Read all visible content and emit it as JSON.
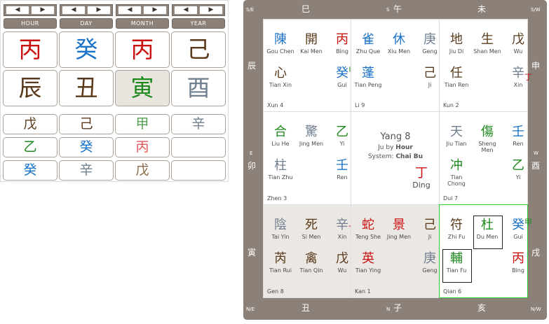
{
  "left_panel": {
    "nav_prev": "◀",
    "nav_next": "▶",
    "columns": [
      "HOUR",
      "DAY",
      "MONTH",
      "YEAR"
    ],
    "stems": [
      {
        "char": "丙",
        "color": "#cc1111"
      },
      {
        "char": "癸",
        "color": "#1a73c8"
      },
      {
        "char": "丙",
        "color": "#cc1111"
      },
      {
        "char": "己",
        "color": "#5a3a1a"
      }
    ],
    "branches": [
      {
        "char": "辰",
        "color": "#5a3a1a",
        "selected": false
      },
      {
        "char": "丑",
        "color": "#5a3a1a",
        "selected": false
      },
      {
        "char": "寅",
        "color": "#1e8a1e",
        "selected": true
      },
      {
        "char": "酉",
        "color": "#708090",
        "selected": false
      }
    ],
    "hidden_stems": [
      [
        {
          "char": "戊",
          "color": "#5a3a1a"
        },
        {
          "char": "乙",
          "color": "#1e8a1e"
        },
        {
          "char": "癸",
          "color": "#1a73c8"
        }
      ],
      [
        {
          "char": "己",
          "color": "#5a3a1a"
        },
        {
          "char": "癸",
          "color": "#1a73c8"
        },
        {
          "char": "辛",
          "color": "#708090"
        }
      ],
      [
        {
          "char": "甲",
          "color": "#55a055"
        },
        {
          "char": "丙",
          "color": "#e05a5a"
        },
        {
          "char": "戊",
          "color": "#8a6a4a"
        }
      ],
      [
        {
          "char": "辛",
          "color": "#708090"
        },
        {
          "char": "",
          "color": "#000"
        },
        {
          "char": "",
          "color": "#000"
        }
      ]
    ]
  },
  "chart": {
    "top_labels": [
      {
        "text": "S/E",
        "kind": "dir"
      },
      {
        "text": "巳",
        "kind": "big"
      },
      {
        "text": "S",
        "kind": "dir"
      },
      {
        "text": "午",
        "kind": "big"
      },
      {
        "text": "未",
        "kind": "big"
      },
      {
        "text": "S/W",
        "kind": "dir"
      }
    ],
    "bottom_labels": [
      {
        "text": "N/E",
        "kind": "dir"
      },
      {
        "text": "丑",
        "kind": "big"
      },
      {
        "text": "N",
        "kind": "dir"
      },
      {
        "text": "子",
        "kind": "big"
      },
      {
        "text": "亥",
        "kind": "big"
      },
      {
        "text": "N/W",
        "kind": "dir"
      }
    ],
    "left_labels": [
      {
        "text": "辰",
        "kind": "big"
      },
      {
        "text": "E",
        "kind": "dir"
      },
      {
        "text": "卯",
        "kind": "big"
      },
      {
        "text": "寅",
        "kind": "big"
      }
    ],
    "right_labels": [
      {
        "text": "申",
        "kind": "big"
      },
      {
        "text": "W",
        "kind": "dir"
      },
      {
        "text": "酉",
        "kind": "big"
      },
      {
        "text": "戌",
        "kind": "big"
      }
    ],
    "center": {
      "title": "Yang 8",
      "ju_prefix": "Ju by ",
      "ju_value": "Hour",
      "system_prefix": "System: ",
      "system_value": "Chai Bu",
      "stem": "丁",
      "stem_label": "Ding"
    },
    "palaces": [
      {
        "name": "Xun 4",
        "shade": false,
        "hl": false,
        "top": [
          {
            "char": "陳",
            "color": "#1a73c8",
            "lbl": "Gou Chen"
          },
          {
            "char": "開",
            "color": "#5a3a1a",
            "lbl": "Kai Men"
          },
          {
            "char": "丙",
            "color": "#cc1111",
            "lbl": "Bing"
          }
        ],
        "bottom": [
          {
            "char": "心",
            "color": "#5a3a1a",
            "lbl": "Tian Xin"
          },
          {
            "char": "",
            "color": "#000",
            "lbl": ""
          },
          {
            "char": "癸",
            "color": "#1a73c8",
            "lbl": "Gui",
            "sup": "甲",
            "sup_color": "#1e8a1e"
          }
        ]
      },
      {
        "name": "Li 9",
        "shade": false,
        "hl": false,
        "top": [
          {
            "char": "雀",
            "color": "#1a73c8",
            "lbl": "Zhu Que"
          },
          {
            "char": "休",
            "color": "#1a73c8",
            "lbl": "Xiu Men"
          },
          {
            "char": "庚",
            "color": "#708090",
            "lbl": "Geng"
          }
        ],
        "bottom": [
          {
            "char": "蓬",
            "color": "#1a73c8",
            "lbl": "Tian Peng"
          },
          {
            "char": "",
            "color": "#000",
            "lbl": ""
          },
          {
            "char": "己",
            "color": "#5a3a1a",
            "lbl": "Ji"
          }
        ]
      },
      {
        "name": "Kun 2",
        "shade": false,
        "hl": false,
        "top": [
          {
            "char": "地",
            "color": "#5a3a1a",
            "lbl": "Jiu Di"
          },
          {
            "char": "生",
            "color": "#5a3a1a",
            "lbl": "Shan Men"
          },
          {
            "char": "戊",
            "color": "#5a3a1a",
            "lbl": "Wu"
          }
        ],
        "bottom": [
          {
            "char": "任",
            "color": "#5a3a1a",
            "lbl": "Tian Ren"
          },
          {
            "char": "",
            "color": "#000",
            "lbl": ""
          },
          {
            "char": "辛",
            "color": "#708090",
            "lbl": "Xin",
            "sup": "丁",
            "sup_color": "#cc1111"
          }
        ]
      },
      {
        "name": "Zhen 3",
        "shade": false,
        "hl": false,
        "top": [
          {
            "char": "合",
            "color": "#1e8a1e",
            "lbl": "Liu He"
          },
          {
            "char": "驚",
            "color": "#708090",
            "lbl": "Jing Men"
          },
          {
            "char": "乙",
            "color": "#1e8a1e",
            "lbl": "Yi"
          }
        ],
        "bottom": [
          {
            "char": "柱",
            "color": "#708090",
            "lbl": "Tian Zhu"
          },
          {
            "char": "",
            "color": "#000",
            "lbl": ""
          },
          {
            "char": "壬",
            "color": "#1a73c8",
            "lbl": "Ren"
          }
        ]
      },
      {
        "name": "",
        "shade": false,
        "hl": false,
        "center": true,
        "top": [],
        "bottom": []
      },
      {
        "name": "Dui 7",
        "shade": false,
        "hl": false,
        "top": [
          {
            "char": "天",
            "color": "#708090",
            "lbl": "Jiu Tian"
          },
          {
            "char": "傷",
            "color": "#1e8a1e",
            "lbl": "Sheng Men"
          },
          {
            "char": "壬",
            "color": "#1a73c8",
            "lbl": "Ren"
          }
        ],
        "bottom": [
          {
            "char": "冲",
            "color": "#1e8a1e",
            "lbl": "Tian Chong"
          },
          {
            "char": "",
            "color": "#000",
            "lbl": ""
          },
          {
            "char": "乙",
            "color": "#1e8a1e",
            "lbl": "Yi"
          }
        ]
      },
      {
        "name": "Gen 8",
        "shade": true,
        "hl": false,
        "top": [
          {
            "char": "陰",
            "color": "#708090",
            "lbl": "Tai Yin"
          },
          {
            "char": "死",
            "color": "#5a3a1a",
            "lbl": "Si Men"
          },
          {
            "char": "辛",
            "color": "#708090",
            "lbl": "Xin",
            "sup": "丁",
            "sup_color": "#cc1111"
          }
        ],
        "bottom": [
          {
            "char": "芮",
            "color": "#5a3a1a",
            "lbl": "Tian Rui"
          },
          {
            "char": "禽",
            "color": "#5a3a1a",
            "lbl": "Tian Qin"
          },
          {
            "char": "戊",
            "color": "#5a3a1a",
            "lbl": "Wu"
          }
        ]
      },
      {
        "name": "Kan 1",
        "shade": true,
        "hl": false,
        "top": [
          {
            "char": "蛇",
            "color": "#cc1111",
            "lbl": "Teng She"
          },
          {
            "char": "景",
            "color": "#cc1111",
            "lbl": "Jing Men"
          },
          {
            "char": "己",
            "color": "#5a3a1a",
            "lbl": "Ji"
          }
        ],
        "bottom": [
          {
            "char": "英",
            "color": "#cc1111",
            "lbl": "Tian Ying"
          },
          {
            "char": "",
            "color": "#000",
            "lbl": ""
          },
          {
            "char": "庚",
            "color": "#708090",
            "lbl": "Geng"
          }
        ]
      },
      {
        "name": "Qian 6",
        "shade": false,
        "hl": true,
        "top": [
          {
            "char": "符",
            "color": "#5a3a1a",
            "lbl": "Zhi Fu"
          },
          {
            "char": "杜",
            "color": "#1e8a1e",
            "lbl": "Du Men",
            "boxed": true
          },
          {
            "char": "癸",
            "color": "#1a73c8",
            "lbl": "Gui",
            "sup": "甲",
            "sup_color": "#1e8a1e"
          }
        ],
        "bottom": [
          {
            "char": "輔",
            "color": "#1e8a1e",
            "lbl": "Tian Fu",
            "boxed": true
          },
          {
            "char": "",
            "color": "#000",
            "lbl": ""
          },
          {
            "char": "丙",
            "color": "#cc1111",
            "lbl": "Bing"
          }
        ]
      }
    ]
  }
}
